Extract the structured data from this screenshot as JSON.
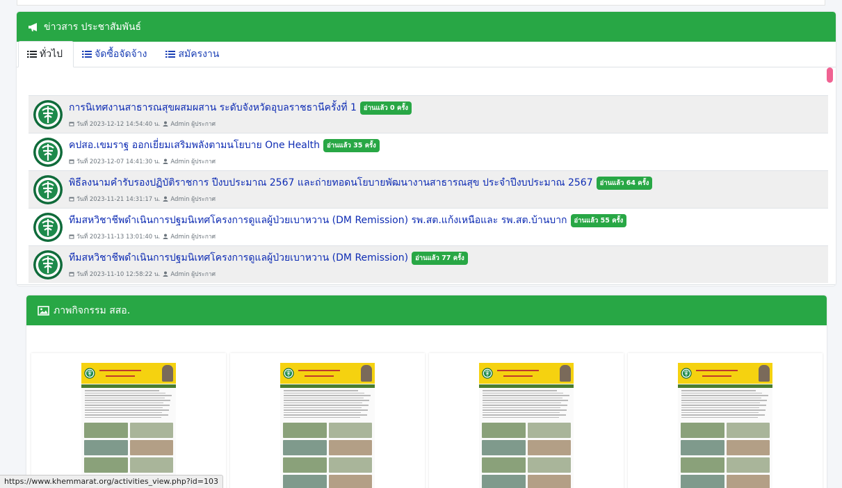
{
  "news": {
    "header_title": "ข่าวสาร ประชาสัมพันธ์",
    "tabs": [
      {
        "label": "ทั่วไป",
        "active": true
      },
      {
        "label": "จัดซื้อจัดจ้าง",
        "active": false
      },
      {
        "label": "สมัครงาน",
        "active": false
      }
    ],
    "items": [
      {
        "title": "การนิเทศงานสาธารณสุขผสมผสาน ระดับจังหวัดอุบลราชธานีครั้งที่ 1",
        "badge": "อ่านแล้ว 0 ครั้ง",
        "date": "วันที่ 2023-12-12 14:54:40 น.",
        "author": "Admin ผู้ประกาศ"
      },
      {
        "title": "คปสอ.เขมราฐ ออกเยี่ยมเสริมพลังตามนโยบาย One Health",
        "badge": "อ่านแล้ว 35 ครั้ง",
        "date": "วันที่ 2023-12-07 14:41:30 น.",
        "author": "Admin ผู้ประกาศ"
      },
      {
        "title": "พิธีลงนามคำรับรองปฏิบัติราชการ ปีงบประมาณ 2567 และถ่ายทอดนโยบายพัฒนางานสาธารณสุข ประจำปีงบประมาณ 2567",
        "badge": "อ่านแล้ว 64 ครั้ง",
        "date": "วันที่ 2023-11-21 14:31:17 น.",
        "author": "Admin ผู้ประกาศ"
      },
      {
        "title": "ทีมสหวิชาชีพดำเนินการปฐมนิเทศโครงการดูแลผู้ป่วยเบาหวาน (DM Remission) รพ.สต.แก้งเหนือและ รพ.สต.บ้านบาก",
        "badge": "อ่านแล้ว 55 ครั้ง",
        "date": "วันที่ 2023-11-13 13:01:40 น.",
        "author": "Admin ผู้ประกาศ"
      },
      {
        "title": "ทีมสหวิชาชีพดำเนินการปฐมนิเทศโครงการดูแลผู้ป่วยเบาหวาน (DM Remission)",
        "badge": "อ่านแล้ว 77 ครั้ง",
        "date": "วันที่ 2023-11-10 12:58:22 น.",
        "author": "Admin ผู้ประกาศ"
      }
    ]
  },
  "activities": {
    "header_title": "ภาพกิจกรรม สสอ."
  },
  "status_url": "https://www.khemmarat.org/activities_view.php?id=103",
  "colors": {
    "header_green": "#28a745",
    "link_blue": "#0d2bb3",
    "scroll_pink": "#f06292"
  },
  "icons": {
    "news_header": "bullhorn-icon",
    "tab": "list-icon",
    "date": "calendar-icon",
    "author": "user-icon",
    "activities_header": "image-icon"
  }
}
